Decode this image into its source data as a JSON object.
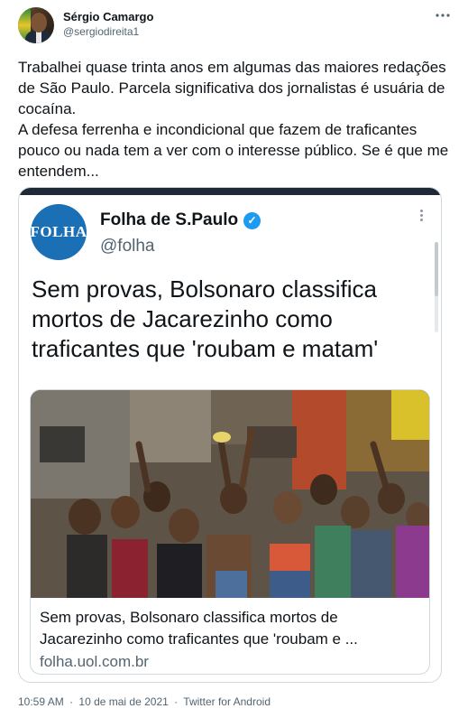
{
  "author": {
    "display_name": "Sérgio Camargo",
    "handle": "@sergiodireita1"
  },
  "tweet": {
    "text": "Trabalhei quase trinta anos em algumas das maiores redações de São Paulo. Parcela significativa dos jornalistas é usuária de cocaína.\nA defesa ferrenha e incondicional que fazem de traficantes pouco ou nada tem a ver com o interesse público. Se é que me entendem..."
  },
  "embedded_tweet": {
    "logo_text": "FOLHA",
    "display_name": "Folha de S.Paulo",
    "verified_glyph": "✓",
    "handle": "@folha",
    "headline": "Sem provas, Bolsonaro classifica mortos de Jacarezinho como traficantes que 'roubam e matam'",
    "link_card": {
      "title": "Sem provas, Bolsonaro classifica mortos de Jacarezinho como traficantes que 'roubam e ...",
      "domain": "folha.uol.com.br"
    }
  },
  "meta": {
    "time": "10:59 AM",
    "separator": "·",
    "date": "10 de mai de 2021",
    "source": "Twitter for Android"
  },
  "icons": {
    "menu": "more-horizontal-icon",
    "verified": "verified-badge-icon",
    "embed_menu": "more-vertical-icon"
  },
  "colors": {
    "accent": "#1d9bf0",
    "secondary_text": "#536471",
    "folha_blue": "#1a6fb5"
  }
}
